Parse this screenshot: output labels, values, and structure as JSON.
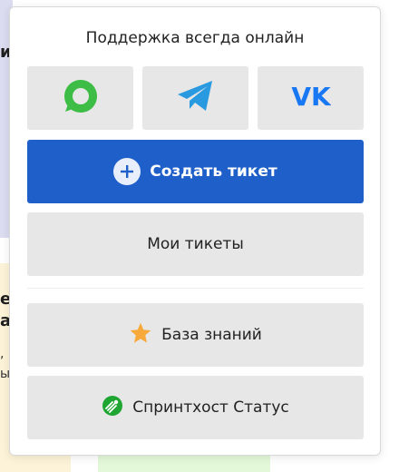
{
  "background": {
    "fragment_1": "ии",
    "fragment_2": "е",
    "fragment_3": "а",
    "fragment_4": ",",
    "fragment_5": "ы"
  },
  "popup": {
    "title": "Поддержка всегда онлайн",
    "messengers": [
      {
        "name": "whatsapp",
        "icon": "whatsapp-icon",
        "color": "#3ebd46"
      },
      {
        "name": "telegram",
        "icon": "telegram-icon",
        "color": "#2a9ae0"
      },
      {
        "name": "vk",
        "icon": "vk-icon",
        "color": "#1877f2"
      }
    ],
    "create_ticket_label": "Создать тикет",
    "my_tickets_label": "Мои тикеты",
    "knowledge_base_label": "База знаний",
    "status_label": "Спринтхост Статус",
    "colors": {
      "primary": "#1f5fc9",
      "button_gray": "#e7e7e7",
      "star": "#f7a93b",
      "status_green": "#1fa531"
    }
  }
}
